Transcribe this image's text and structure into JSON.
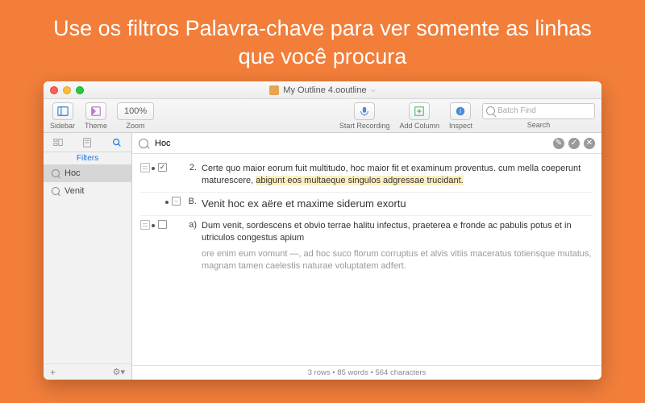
{
  "headline": "Use os filtros Palavra-chave para ver somente as linhas que você procura",
  "window": {
    "title": "My Outline 4.ooutline"
  },
  "toolbar": {
    "sidebar_label": "Sidebar",
    "theme_label": "Theme",
    "zoom_label": "Zoom",
    "zoom_value": "100%",
    "start_recording_label": "Start Recording",
    "add_column_label": "Add Column",
    "inspect_label": "Inspect",
    "search_label": "Search",
    "search_placeholder": "Batch Find"
  },
  "sidebar": {
    "filters_label": "Filters",
    "items": [
      "Hoc",
      "Venit"
    ]
  },
  "filterbar": {
    "query": "Hoc"
  },
  "content": {
    "rows": [
      {
        "marker": "2.",
        "text_a": "Certe quo maior eorum fuit multitudo, hoc maior fit et examinum proventus. cum mella coeperunt maturescere, ",
        "text_b": "abigunt eos multaeque singulos adgressae trucidant.",
        "checked": true
      },
      {
        "marker": "B.",
        "text_a": "Venit hoc ex aëre et maxime siderum exortu"
      },
      {
        "marker": "a)",
        "text_a": "Dum venit, sordescens et obvio terrae halitu infectus, praeterea e fronde ac pabulis potus et in utriculos congestus apium",
        "sub": "ore enim eum vomunt —, ad hoc suco florum corruptus et alvis vitiis maceratus totiensque mutatus, magnam tamen caelestis naturae voluptatem adfert."
      }
    ]
  },
  "status": {
    "rows": "3 rows",
    "words": "85 words",
    "chars": "564 characters"
  }
}
